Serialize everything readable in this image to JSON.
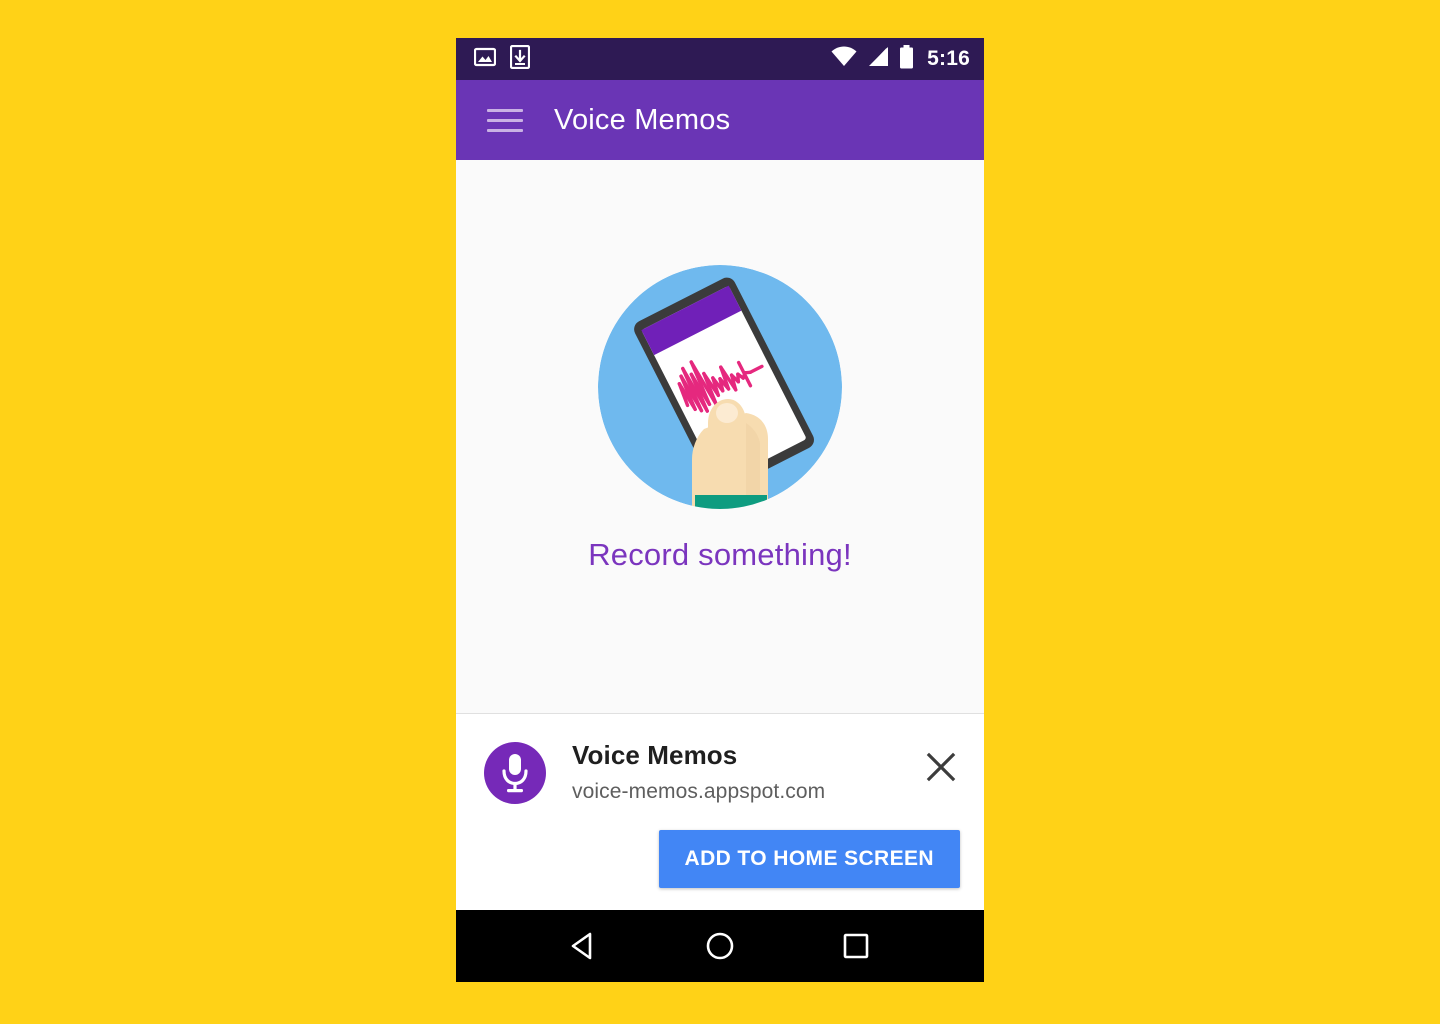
{
  "background": {
    "color": "#FFD217"
  },
  "device": {
    "status_bar": {
      "background": "#2E1A54",
      "clock": "5:16",
      "notification_icons": [
        {
          "name": "image-icon",
          "label": "Screenshot captured"
        },
        {
          "name": "download-icon",
          "label": "Download complete"
        }
      ],
      "system_icons": [
        {
          "name": "wifi-icon",
          "label": "Wi-Fi connected"
        },
        {
          "name": "signal-icon",
          "label": "Cellular signal"
        },
        {
          "name": "battery-icon",
          "label": "Battery"
        }
      ]
    },
    "app_bar": {
      "background": "#6A35B5",
      "menu_icon": "hamburger-menu-icon",
      "title": "Voice Memos"
    },
    "content": {
      "background": "#FAFAFA",
      "illustration": {
        "name": "hand-holding-phone-illustration",
        "circle_color": "#6FB9EE",
        "phone_frame_color": "#3A3A3A",
        "phone_screen_color": "#FFFFFF",
        "phone_appbar_color": "#7020B8",
        "waveform_color": "#E5287E",
        "skin_color": "#F7DCB0",
        "sleeve_color": "#0E9C80"
      },
      "empty_state_text": "Record something!",
      "empty_state_text_color": "#7B35BE"
    },
    "install_banner": {
      "background": "#FFFFFF",
      "app_icon": {
        "name": "microphone-icon",
        "circle_color": "#7629B8",
        "glyph_color": "#FFFFFF"
      },
      "app_name": "Voice Memos",
      "app_url": "voice-memos.appspot.com",
      "close_icon": "close-icon",
      "install_button_label": "ADD TO HOME SCREEN",
      "install_button_color": "#4286F5"
    },
    "nav_bar": {
      "background": "#000000",
      "buttons": [
        {
          "name": "back-button",
          "icon": "triangle-left-icon"
        },
        {
          "name": "home-button",
          "icon": "circle-icon"
        },
        {
          "name": "recents-button",
          "icon": "square-icon"
        }
      ]
    }
  }
}
